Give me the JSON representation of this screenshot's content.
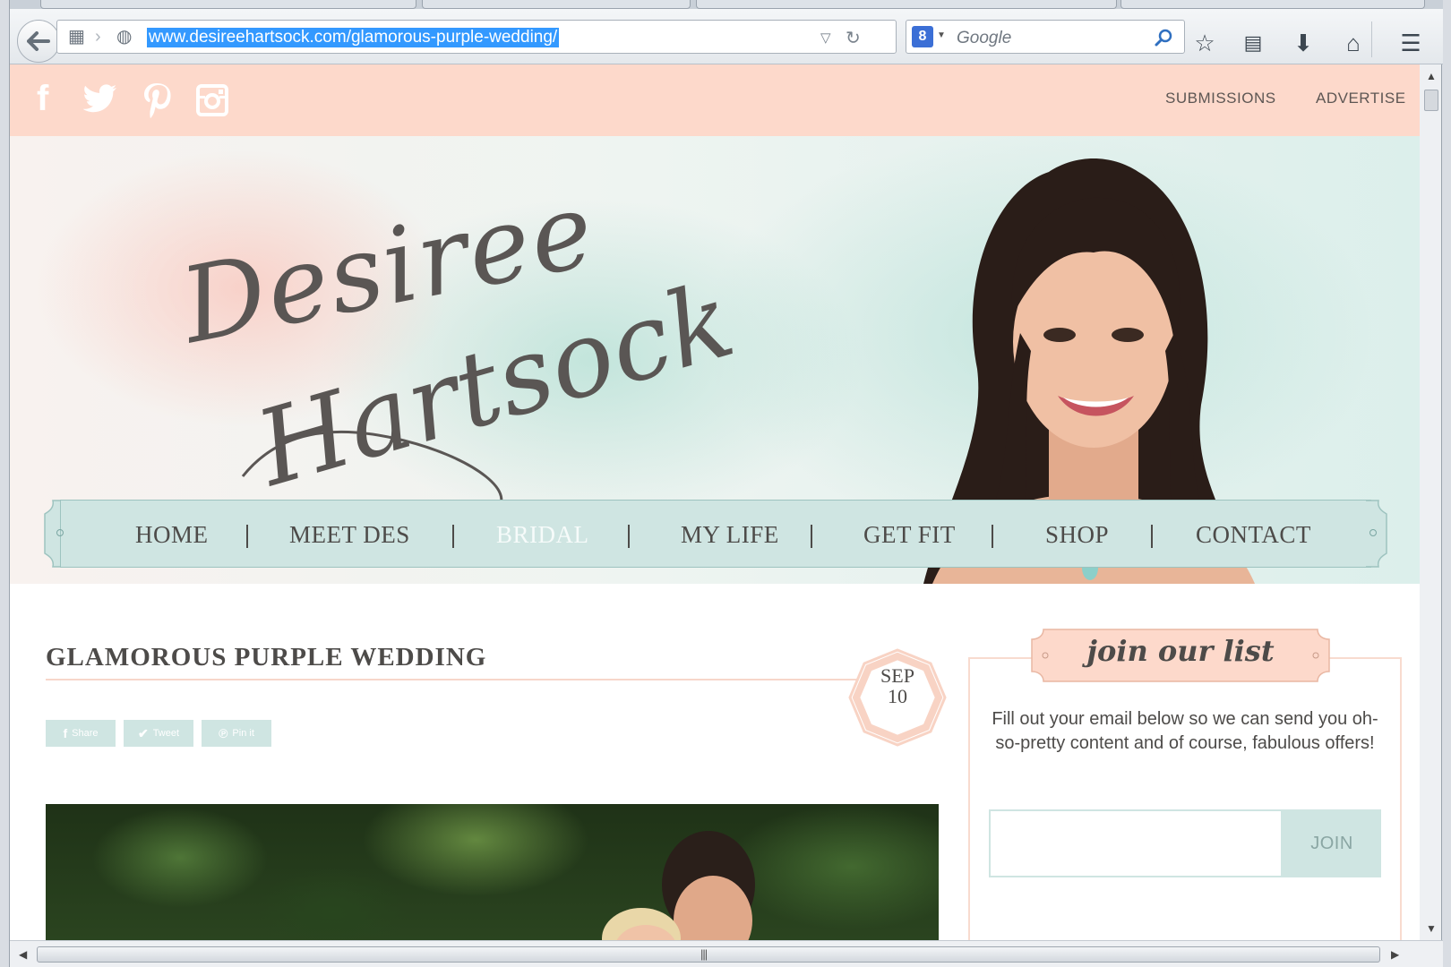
{
  "browser": {
    "url": "www.desireehartsock.com/glamorous-purple-wedding/",
    "search_placeholder": "Google",
    "search_engine_badge": "8"
  },
  "site": {
    "social_icons": [
      "facebook-icon",
      "twitter-icon",
      "pinterest-icon",
      "instagram-icon"
    ],
    "top_links": [
      "SUBMISSIONS",
      "ADVERTISE"
    ],
    "logo_line1": "Desiree",
    "logo_line2": "Hartsock",
    "nav": {
      "items": [
        "HOME",
        "MEET DES",
        "BRIDAL",
        "MY LIFE",
        "GET FIT",
        "SHOP",
        "CONTACT"
      ],
      "active": "BRIDAL"
    },
    "post": {
      "title": "GLAMOROUS PURPLE WEDDING",
      "date_month": "SEP",
      "date_day": "10",
      "share_labels": [
        "Share",
        "Tweet",
        "Pin it"
      ]
    },
    "sidebar": {
      "heading": "join our list",
      "description": "Fill out your email below so we can send you oh-so-pretty content and of course, fabulous offers!",
      "email_value": "",
      "join_label": "JOIN"
    }
  },
  "colors": {
    "topbar": "#fdd9cb",
    "nav_bg": "#cfe5e2",
    "text": "#4d4b49",
    "accent_peach": "#f8dbcf"
  }
}
